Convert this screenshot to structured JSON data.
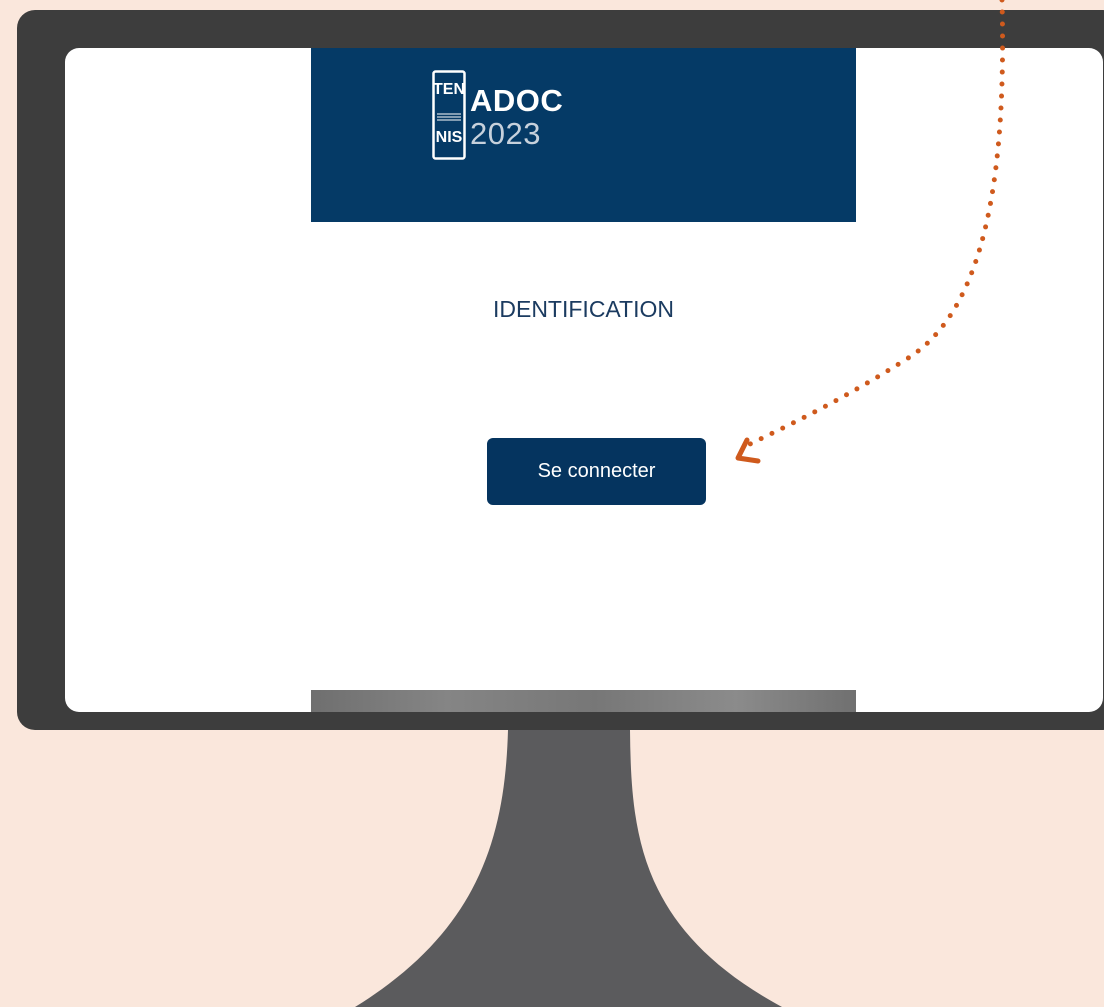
{
  "brand": {
    "logo_icon": "tennis-logo-icon",
    "logo_text_top": "TEN",
    "logo_text_bottom": "NIS",
    "title": "ADOC",
    "year": "2023"
  },
  "page": {
    "heading": "IDENTIFICATION"
  },
  "actions": {
    "login_label": "Se connecter"
  },
  "annotation": {
    "arrow_icon": "dotted-arrow-icon"
  },
  "colors": {
    "background": "#fae7dc",
    "monitor": "#3d3d3d",
    "header": "#053a66",
    "button": "#05345f",
    "annotation": "#cf5a1d"
  }
}
